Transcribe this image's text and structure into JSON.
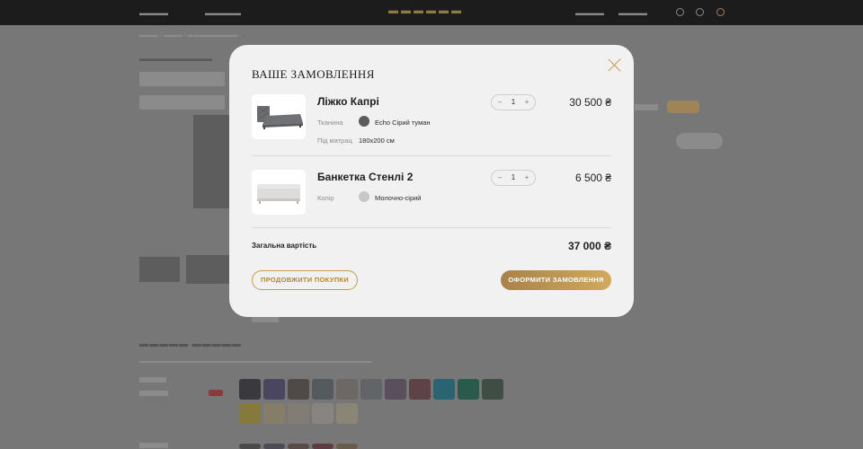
{
  "modal": {
    "title": "ВАШЕ ЗАМОВЛЕННЯ",
    "close_icon": "close-icon",
    "items": [
      {
        "name": "Ліжко Капрі",
        "attributes": [
          {
            "label": "Тканина",
            "value": "Echo Сірий туман",
            "swatch_color": "#5b5b5d"
          },
          {
            "label": "Під матрац",
            "value": "180х200 см"
          }
        ],
        "quantity": "1",
        "minus": "–",
        "plus": "+",
        "price": "30 500 ₴"
      },
      {
        "name": "Банкетка Стенлі 2",
        "attributes": [
          {
            "label": "Колір",
            "value": "Молочно-сірий",
            "swatch_color": "#c9c6c6"
          }
        ],
        "quantity": "1",
        "minus": "–",
        "plus": "+",
        "price": "6 500 ₴"
      }
    ],
    "total_label": "Загальна вартість",
    "total_value": "37 000 ₴",
    "continue_label": "ПРОДОВЖИТИ ПОКУПКИ",
    "checkout_label": "ОФОРМИТИ ЗАМОВЛЕННЯ"
  },
  "colors": {
    "accent_gold": "#c59b4a",
    "overlay": "#6e6e6e",
    "modal_bg": "#f1f1f2"
  }
}
